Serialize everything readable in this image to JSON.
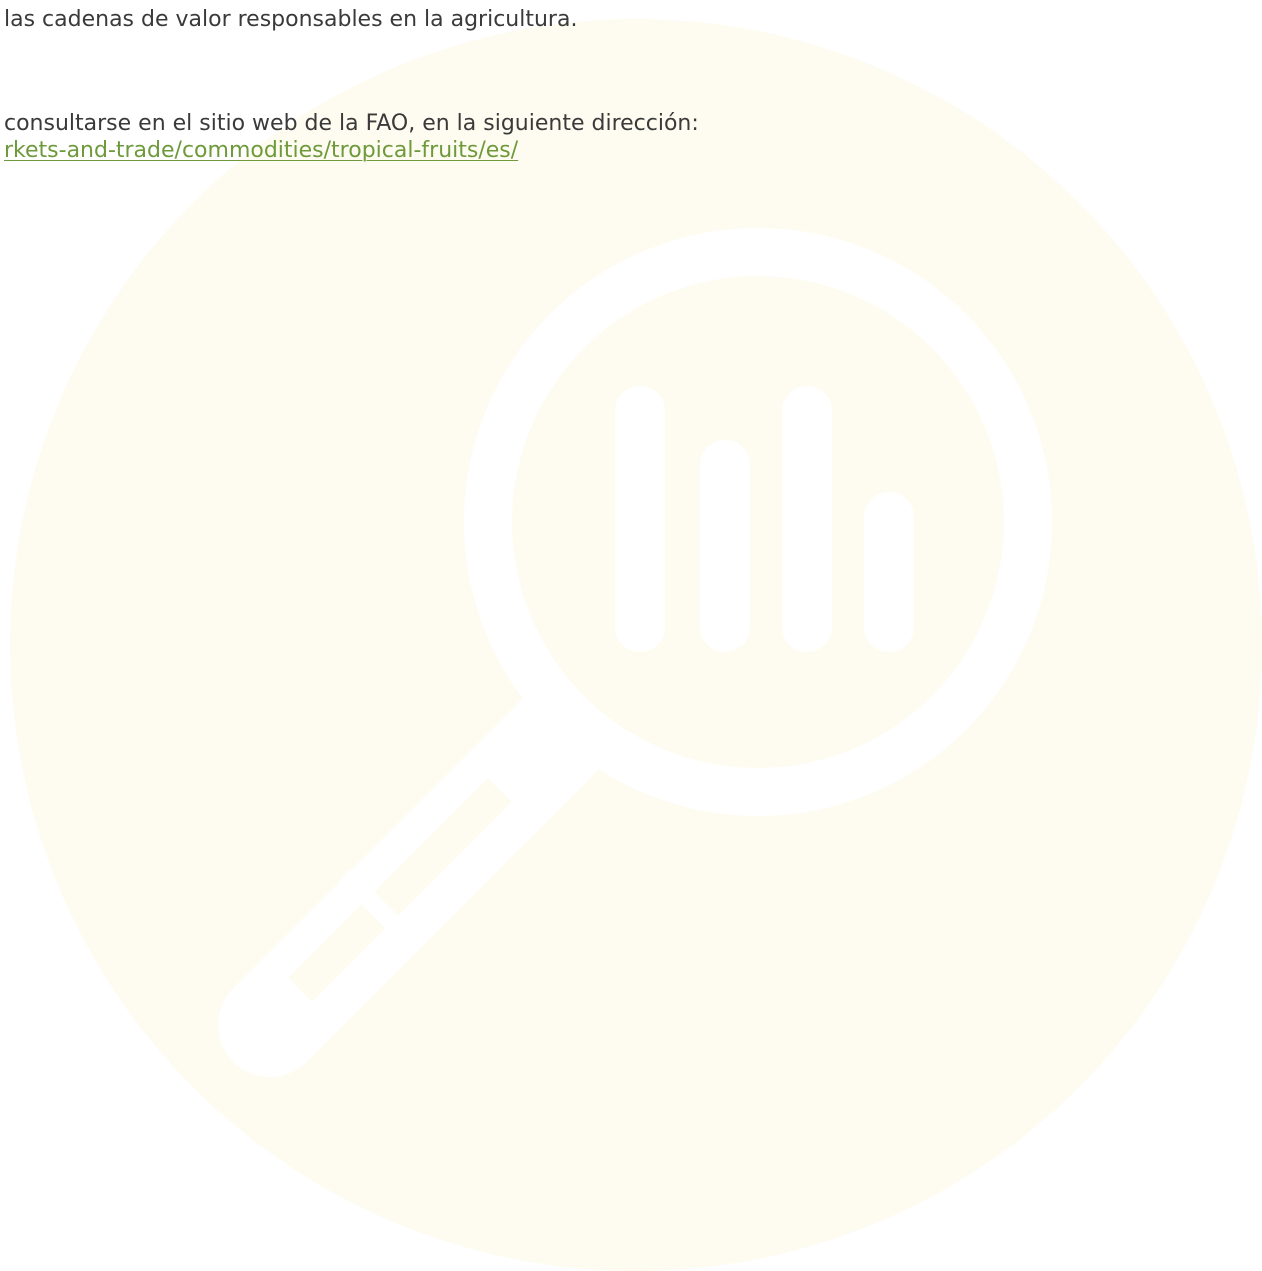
{
  "document": {
    "paragraph_1_tail": "las cadenas de valor responsables en la agricultura.",
    "paragraph_2_line_1": "consultarse en el sitio web de la FAO, en la siguiente dirección:",
    "paragraph_2_link": "rkets-and-trade/commodities/tropical-fruits/es/"
  },
  "illustration": {
    "icon": "magnifying-glass-bar-chart-icon",
    "background_color": "#fefcf1",
    "icon_color": "#ffffff"
  },
  "colors": {
    "body_text": "#3a3a3a",
    "link": "#6e9a3c"
  }
}
